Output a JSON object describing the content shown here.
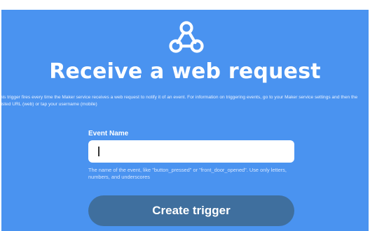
{
  "header": {
    "logo_icon": "webhook-icon",
    "title": "Receive a web request"
  },
  "description": "his trigger fires every time the Maker service receives a web request to notify it of an event. For information on triggering events, go to your Maker service settings and then the listed URL (web) or tap your username (mobile)",
  "form": {
    "event_name_label": "Event Name",
    "event_name_value": "",
    "helper_text": "The name of the event, like \"button_pressed\" or \"front_door_opened\". Use only letters, numbers, and underscores"
  },
  "actions": {
    "create_trigger_label": "Create trigger"
  },
  "colors": {
    "panel_background": "#4a93f0",
    "button_background": "#3f6f9e",
    "text": "#ffffff"
  }
}
